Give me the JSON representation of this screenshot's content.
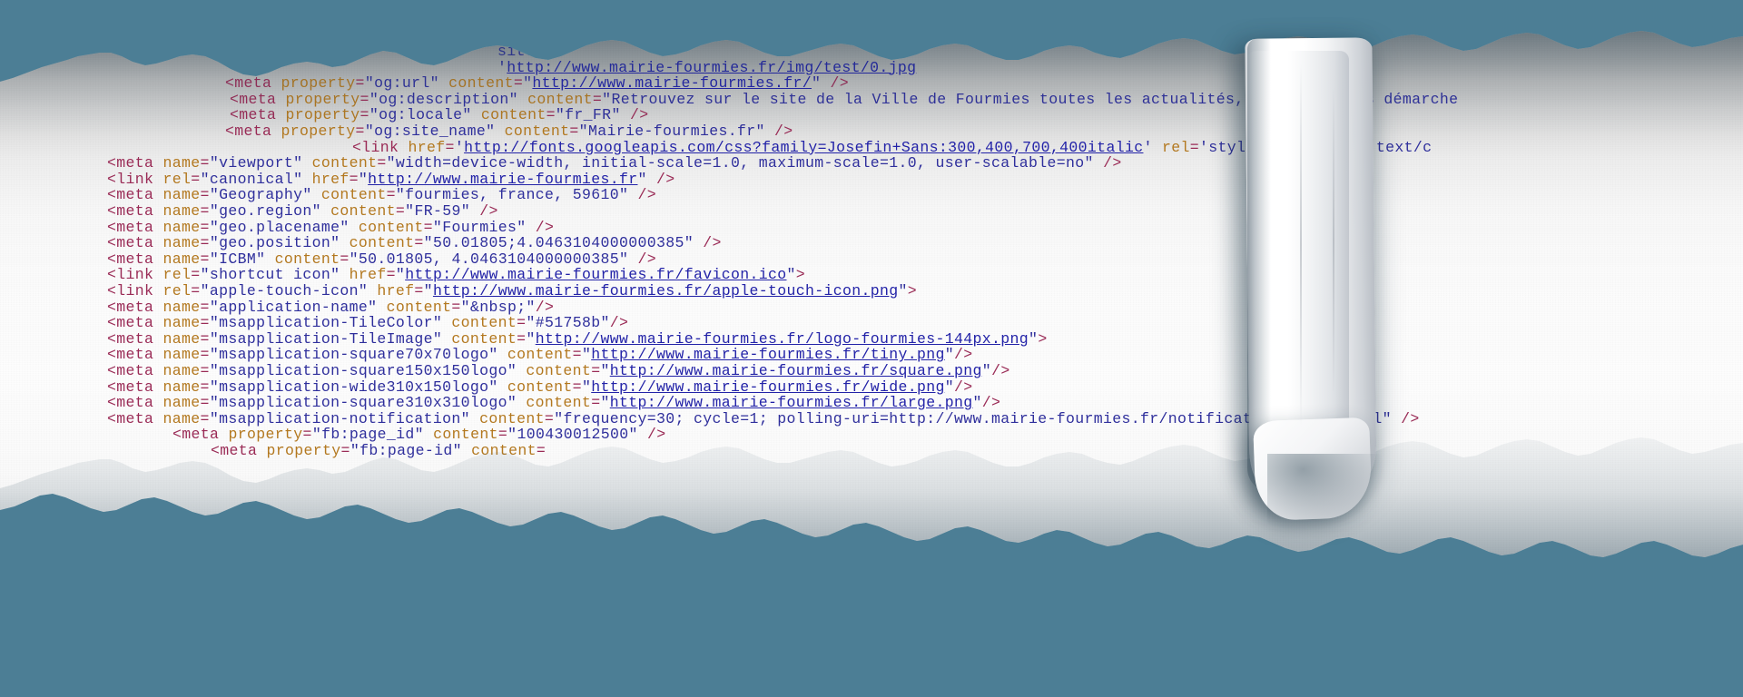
{
  "scene": {
    "name": "torn-paper-html-source-reveal",
    "background_color": "#4c7e95",
    "paper_color": "#fbfbfb",
    "accent_link_color": "#2323a8",
    "tag_color": "#9a2b56",
    "attr_color": "#b3781f",
    "value_color": "#2f2f9c"
  },
  "code": {
    "language": "html",
    "lines": [
      {
        "id": "l01",
        "indent": "i4",
        "clipped": "top",
        "text": "site"
      },
      {
        "id": "l02",
        "indent": "i4",
        "clipped": "top",
        "text": "'http://www.mairie-fourmies.fr/img/test/0.jpg"
      },
      {
        "id": "l03",
        "indent": "i2",
        "clipped": "top",
        "text": "<meta property=\"og:url\" content=\"http://www.mairie-fourmies.fr/\" />"
      },
      {
        "id": "l04",
        "indent": "i1",
        "text": "<meta property=\"og:description\" content=\"Retrouvez sur le site de la Ville de Fourmies toutes les actualités, l'agenda, les démarche"
      },
      {
        "id": "l05",
        "indent": "i1",
        "text": "<meta property=\"og:locale\" content=\"fr_FR\" />"
      },
      {
        "id": "l06",
        "indent": "i2",
        "text": "<meta property=\"og:site_name\" content=\"Mairie-fourmies.fr\" />"
      },
      {
        "id": "l07",
        "indent": "i3",
        "text": "<link href='http://fonts.googleapis.com/css?family=Josefin+Sans:300,400,700,400italic' rel='stylesheet' type='text/c"
      },
      {
        "id": "l08",
        "indent": "i0",
        "text": "<meta name=\"viewport\" content=\"width=device-width, initial-scale=1.0, maximum-scale=1.0, user-scalable=no\" />"
      },
      {
        "id": "l09",
        "indent": "i0",
        "text": "<link rel=\"canonical\" href=\"http://www.mairie-fourmies.fr\" />"
      },
      {
        "id": "l10",
        "indent": "i0",
        "text": "<meta name=\"Geography\" content=\"fourmies, france, 59610\" />"
      },
      {
        "id": "l11",
        "indent": "i0",
        "text": "<meta name=\"geo.region\" content=\"FR-59\" />"
      },
      {
        "id": "l12",
        "indent": "i0",
        "text": "<meta name=\"geo.placename\" content=\"Fourmies\" />"
      },
      {
        "id": "l13",
        "indent": "i0",
        "text": "<meta name=\"geo.position\" content=\"50.01805;4.0463104000000385\" />"
      },
      {
        "id": "l14",
        "indent": "i0",
        "text": "<meta name=\"ICBM\" content=\"50.01805, 4.0463104000000385\" />"
      },
      {
        "id": "l15",
        "indent": "i0",
        "text": "<link rel=\"shortcut icon\" href=\"http://www.mairie-fourmies.fr/favicon.ico\">"
      },
      {
        "id": "l16",
        "indent": "i0",
        "text": "<link rel=\"apple-touch-icon\" href=\"http://www.mairie-fourmies.fr/apple-touch-icon.png\">"
      },
      {
        "id": "l17",
        "indent": "i0",
        "text": "<meta name=\"application-name\" content=\"&nbsp;\"/>"
      },
      {
        "id": "l18",
        "indent": "i0",
        "text": "<meta name=\"msapplication-TileColor\" content=\"#51758b\"/>"
      },
      {
        "id": "l19",
        "indent": "i0",
        "text": "<meta name=\"msapplication-TileImage\" content=\"http://www.mairie-fourmies.fr/logo-fourmies-144px.png\">"
      },
      {
        "id": "l20",
        "indent": "i0",
        "text": "<meta name=\"msapplication-square70x70logo\" content=\"http://www.mairie-fourmies.fr/tiny.png\"/>"
      },
      {
        "id": "l21",
        "indent": "i0",
        "text": "<meta name=\"msapplication-square150x150logo\" content=\"http://www.mairie-fourmies.fr/square.png\"/>"
      },
      {
        "id": "l22",
        "indent": "i0",
        "text": "<meta name=\"msapplication-wide310x150logo\" content=\"http://www.mairie-fourmies.fr/wide.png\"/>"
      },
      {
        "id": "l23",
        "indent": "i0",
        "text": "<meta name=\"msapplication-square310x310logo\" content=\"http://www.mairie-fourmies.fr/large.png\"/>"
      },
      {
        "id": "l24",
        "indent": "i0",
        "text": "<meta name=\"msapplication-notification\" content=\"frequency=30; cycle=1; polling-uri=http://www.mairie-fourmies.fr/notifications/slide.xml\" />"
      },
      {
        "id": "l25",
        "indent": "i6",
        "clipped": "bottom",
        "text": "<meta property=\"fb:page_id\" content=\"100430012500\" />"
      },
      {
        "id": "l26",
        "indent": "i7",
        "clipped": "bottom",
        "text": "<meta property=\"fb:page-id\" content="
      }
    ]
  },
  "highlighted_tokens": {
    "links": [
      "http://fonts.googleapis.com/css?family=Josefin+Sans:300,400,700,400italic",
      "http://www.mairie-fourmies.fr",
      "http://www.mairie-fourmies.fr/favicon.ico",
      "http://www.mairie-fourmies.fr/apple-touch-icon.png"
    ]
  },
  "curl": {
    "name": "rolled-paper-curl",
    "position": "right"
  }
}
